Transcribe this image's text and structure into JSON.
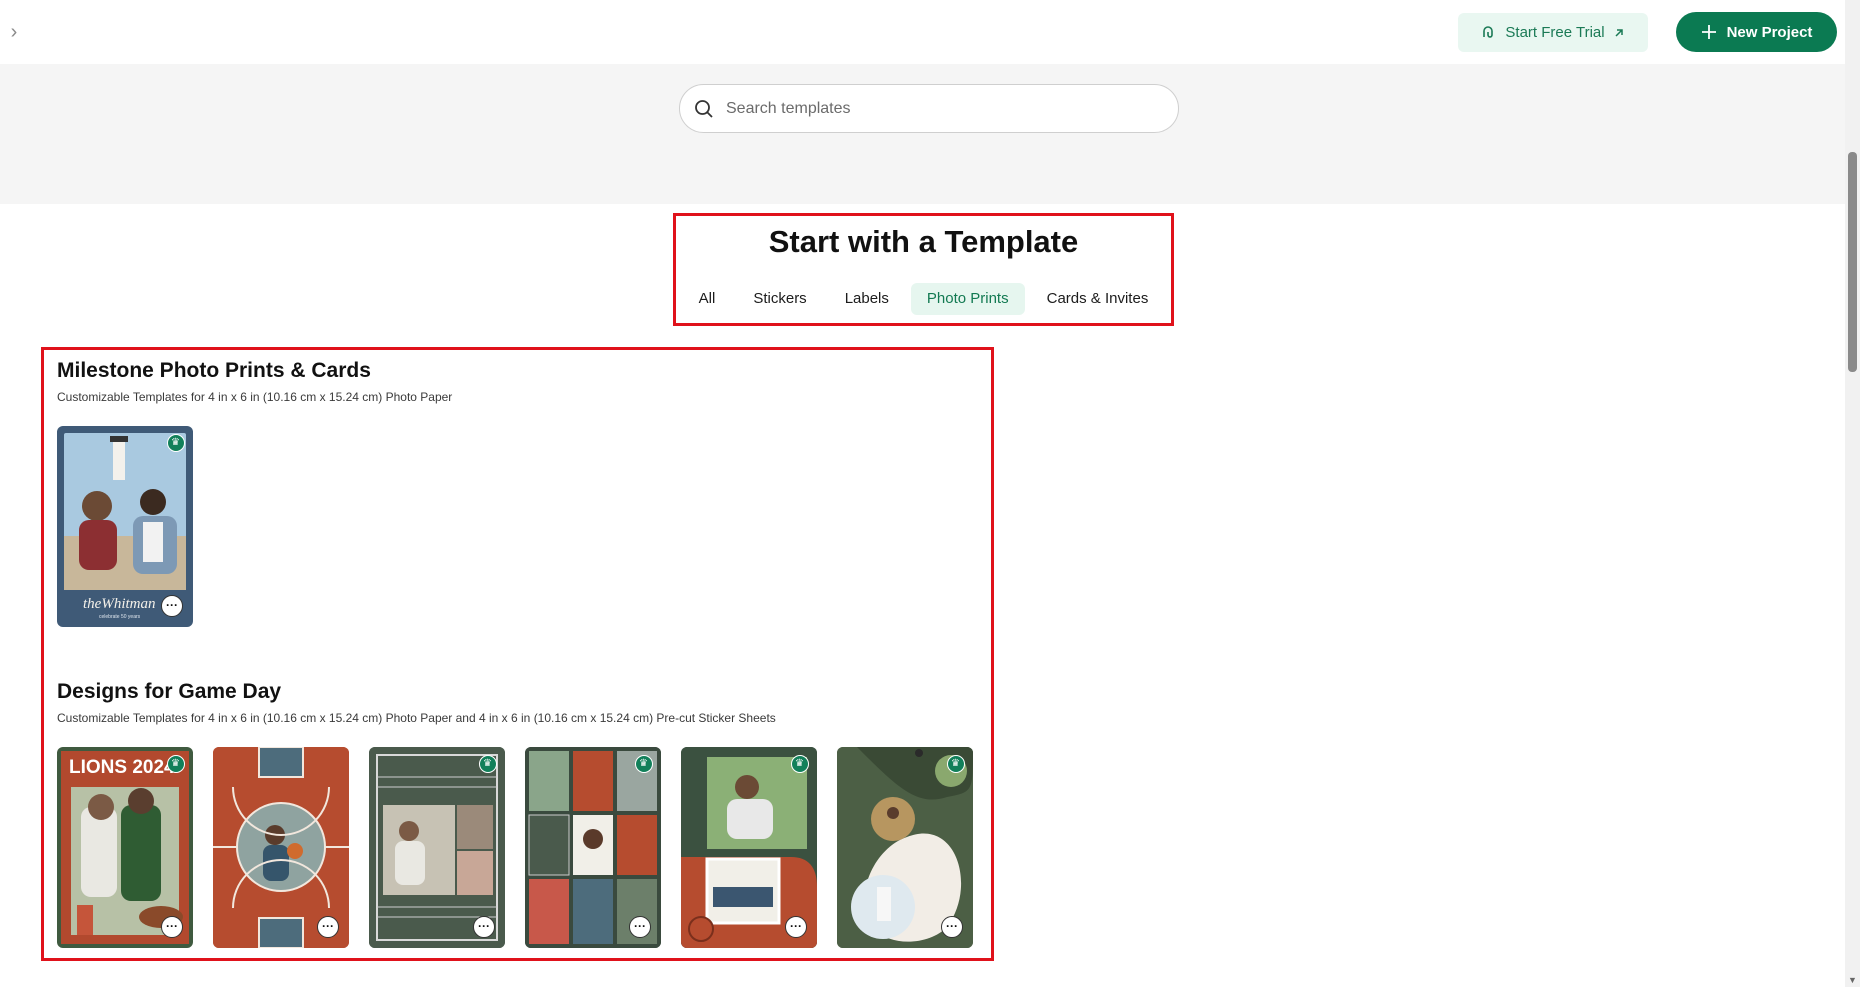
{
  "topbar": {
    "trial_label": "Start Free Trial",
    "new_project_label": "New Project"
  },
  "search": {
    "placeholder": "Search templates"
  },
  "header": {
    "title": "Start with a Template",
    "tabs": [
      {
        "label": "All",
        "active": false
      },
      {
        "label": "Stickers",
        "active": false
      },
      {
        "label": "Labels",
        "active": false
      },
      {
        "label": "Photo Prints",
        "active": true
      },
      {
        "label": "Cards & Invites",
        "active": false
      }
    ]
  },
  "sections": [
    {
      "title": "Milestone Photo Prints & Cards",
      "subtitle": "Customizable Templates for 4 in x 6 in (10.16 cm x 15.24 cm) Photo Paper",
      "cards": [
        {
          "caption": "theWhitman",
          "caption_sub": "celebrate 50 years"
        }
      ]
    },
    {
      "title": "Designs for Game Day",
      "subtitle": "Customizable Templates for 4 in x 6 in (10.16 cm x 15.24 cm) Photo Paper and 4 in x 6 in (10.16 cm x 15.24 cm) Pre-cut Sticker Sheets",
      "cards": [
        {
          "caption": "LIONS 2024"
        },
        {
          "caption": ""
        },
        {
          "caption": ""
        },
        {
          "caption": ""
        },
        {
          "caption": ""
        },
        {
          "caption": ""
        }
      ]
    }
  ],
  "colors": {
    "brand": "#0b7a52",
    "highlight_border": "#e0121b",
    "tab_active_bg": "#e6f6ef"
  }
}
